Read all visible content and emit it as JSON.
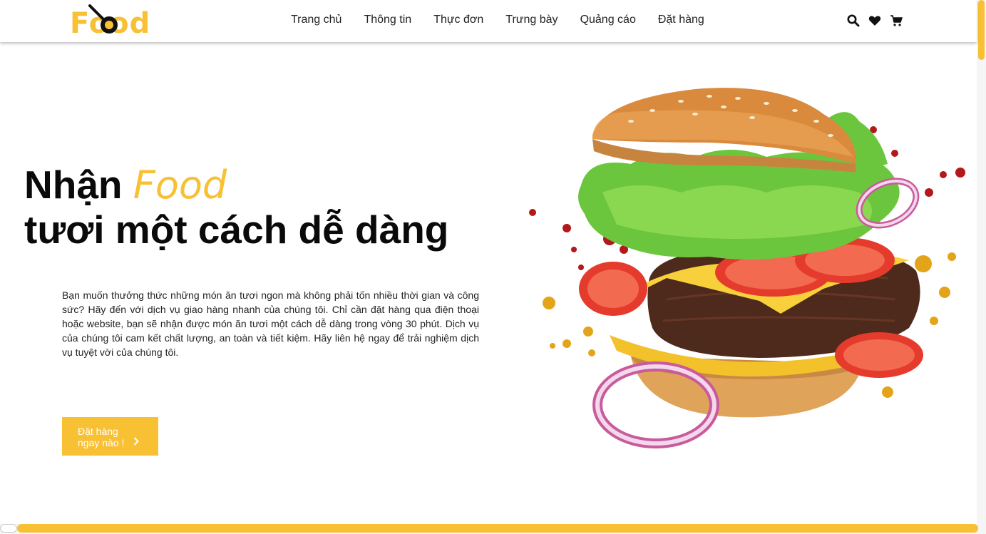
{
  "header": {
    "logo_text": "Food",
    "nav": [
      {
        "label": "Trang chủ"
      },
      {
        "label": "Thông tin"
      },
      {
        "label": "Thực đơn"
      },
      {
        "label": "Trưng bày"
      },
      {
        "label": "Quảng cáo"
      },
      {
        "label": "Đặt hàng"
      }
    ],
    "icons": [
      "search-icon",
      "heart-icon",
      "cart-icon"
    ]
  },
  "hero": {
    "headline_prefix": "Nhận ",
    "headline_accent": "Food",
    "headline_line2": "tươi một cách dễ dàng",
    "description": "Bạn muốn thưởng thức những món ăn tươi ngon mà không phải tốn nhiều thời gian và công sức? Hãy đến với dịch vụ giao hàng nhanh của chúng tôi. Chỉ cần đặt hàng qua điện thoại hoặc website, bạn sẽ nhận được món ăn tươi một cách dễ dàng trong vòng 30 phút. Dịch vụ của chúng tôi cam kết chất lượng, an toàn và tiết kiệm. Hãy liên hệ ngay để trải nghiệm dịch vụ tuyệt vời của chúng tôi.",
    "cta_line1": "Đặt hàng",
    "cta_line2": "ngay nào !"
  },
  "colors": {
    "accent": "#f8c033",
    "text": "#0a0a0a"
  }
}
